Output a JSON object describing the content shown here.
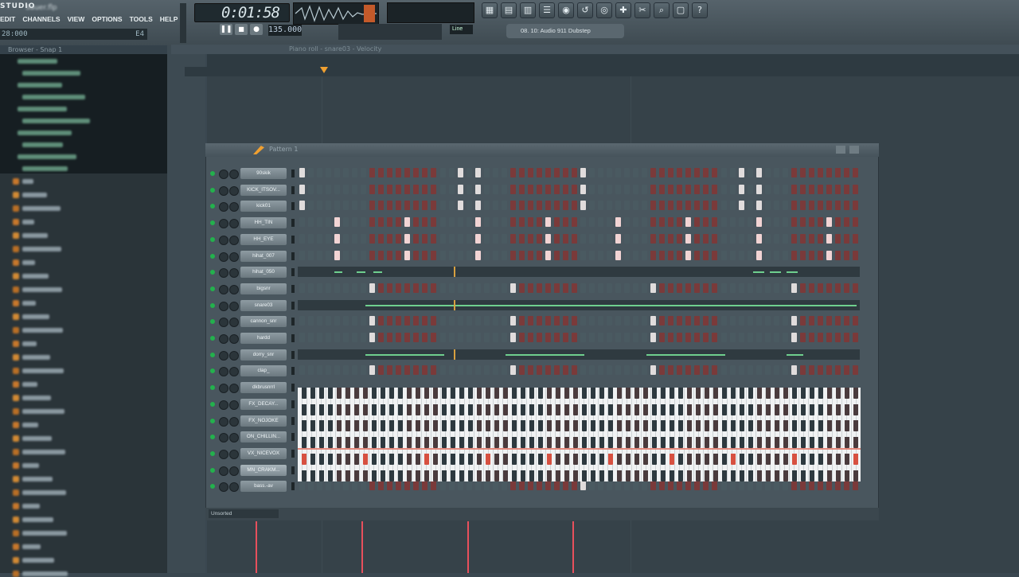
{
  "app": {
    "logo": "STUDIO",
    "title": "Sauer.flp"
  },
  "menu": [
    "EDIT",
    "CHANNELS",
    "VIEW",
    "OPTIONS",
    "TOOLS",
    "HELP"
  ],
  "hint_bar": {
    "left": "28:000",
    "right": "E4"
  },
  "transport": {
    "time": "0:01:58",
    "tempo": "135.000",
    "snap": "Line"
  },
  "song_tab": "08. 10: Audio 911 Dubstep",
  "toolbar_icons": [
    "window-icon",
    "playlist-icon",
    "piano-roll-icon",
    "channel-rack-icon",
    "mixer-icon",
    "undo-icon",
    "record-icon",
    "plugin-icon",
    "scissors-icon",
    "zoom-icon",
    "file-icon",
    "help-icon"
  ],
  "browser": {
    "title": "Browser - Snap 1"
  },
  "piano_roll": {
    "label": "Piano roll - snare03 - Velocity"
  },
  "channel_rack": {
    "title": "Pattern 1",
    "group": "Unsorted",
    "channels": [
      {
        "name": "90skik",
        "type": "steps",
        "on": [
          0,
          9,
          10,
          16,
          25,
          26
        ],
        "accent": "#7a3a3a",
        "hi": "#e0dcdc"
      },
      {
        "name": "KICK_ITSOV...",
        "type": "steps",
        "on": [
          0,
          9,
          10,
          16,
          25,
          26
        ],
        "accent": "#7a3a3a",
        "hi": "#e0dcdc"
      },
      {
        "name": "kick01",
        "type": "steps",
        "on": [
          0,
          9,
          10,
          16,
          25,
          26
        ],
        "accent": "#7a3a3a",
        "hi": "#e0dcdc"
      },
      {
        "name": "HH_TIN",
        "type": "steps",
        "on": [
          2,
          6,
          10,
          14,
          18,
          22,
          26,
          30
        ],
        "accent": "#7a3a3a",
        "hi": "#f2d4d4"
      },
      {
        "name": "HH_EYE",
        "type": "steps",
        "on": [
          2,
          6,
          10,
          14,
          18,
          22,
          26,
          30
        ],
        "accent": "#7a3a3a",
        "hi": "#f2d4d4"
      },
      {
        "name": "hihat_007",
        "type": "steps",
        "on": [
          2,
          6,
          10,
          14,
          18,
          22,
          26,
          30
        ],
        "accent": "#7a3a3a",
        "hi": "#f2d4d4"
      },
      {
        "name": "hihat_050",
        "type": "piano",
        "notes": [
          [
            0.065,
            0.08
          ],
          [
            0.105,
            0.12
          ],
          [
            0.135,
            0.15
          ],
          [
            0.81,
            0.83
          ],
          [
            0.84,
            0.86
          ],
          [
            0.87,
            0.89
          ]
        ]
      },
      {
        "name": "bigsnr",
        "type": "steps",
        "on": [
          4,
          12,
          20,
          28
        ],
        "accent": "#7a3a3a",
        "hi": "#e0dcdc"
      },
      {
        "name": "snare03",
        "type": "piano",
        "notes": [
          [
            0.12,
            0.995
          ]
        ]
      },
      {
        "name": "cannon_snr",
        "type": "steps",
        "on": [
          4,
          12,
          20,
          28
        ],
        "accent": "#7a3a3a",
        "hi": "#e0dcdc"
      },
      {
        "name": "hardd",
        "type": "steps",
        "on": [
          4,
          12,
          20,
          28
        ],
        "accent": "#7a3a3a",
        "hi": "#e0dcdc"
      },
      {
        "name": "dorry_snr",
        "type": "piano",
        "notes": [
          [
            0.12,
            0.26
          ],
          [
            0.37,
            0.51
          ],
          [
            0.62,
            0.76
          ],
          [
            0.87,
            0.9
          ]
        ]
      },
      {
        "name": "clap_",
        "type": "steps",
        "on": [
          4,
          12,
          20,
          28
        ],
        "accent": "#7a3a3a",
        "hi": "#e0dcdc"
      },
      {
        "name": "dkbrusnrrl",
        "type": "keys"
      },
      {
        "name": "FX_DECAY...",
        "type": "keys"
      },
      {
        "name": "FX_NOJOKE",
        "type": "keys"
      },
      {
        "name": "ON_CHILLIN...",
        "type": "keys"
      },
      {
        "name": "VX_NICEVOX",
        "type": "keys"
      },
      {
        "name": "MN_CRAKM...",
        "type": "keys",
        "sel": true
      },
      {
        "name": "bass.-av",
        "type": "steps",
        "on": [
          16
        ],
        "accent": "#7a3a3a",
        "hi": "#e0dcdc"
      }
    ]
  }
}
